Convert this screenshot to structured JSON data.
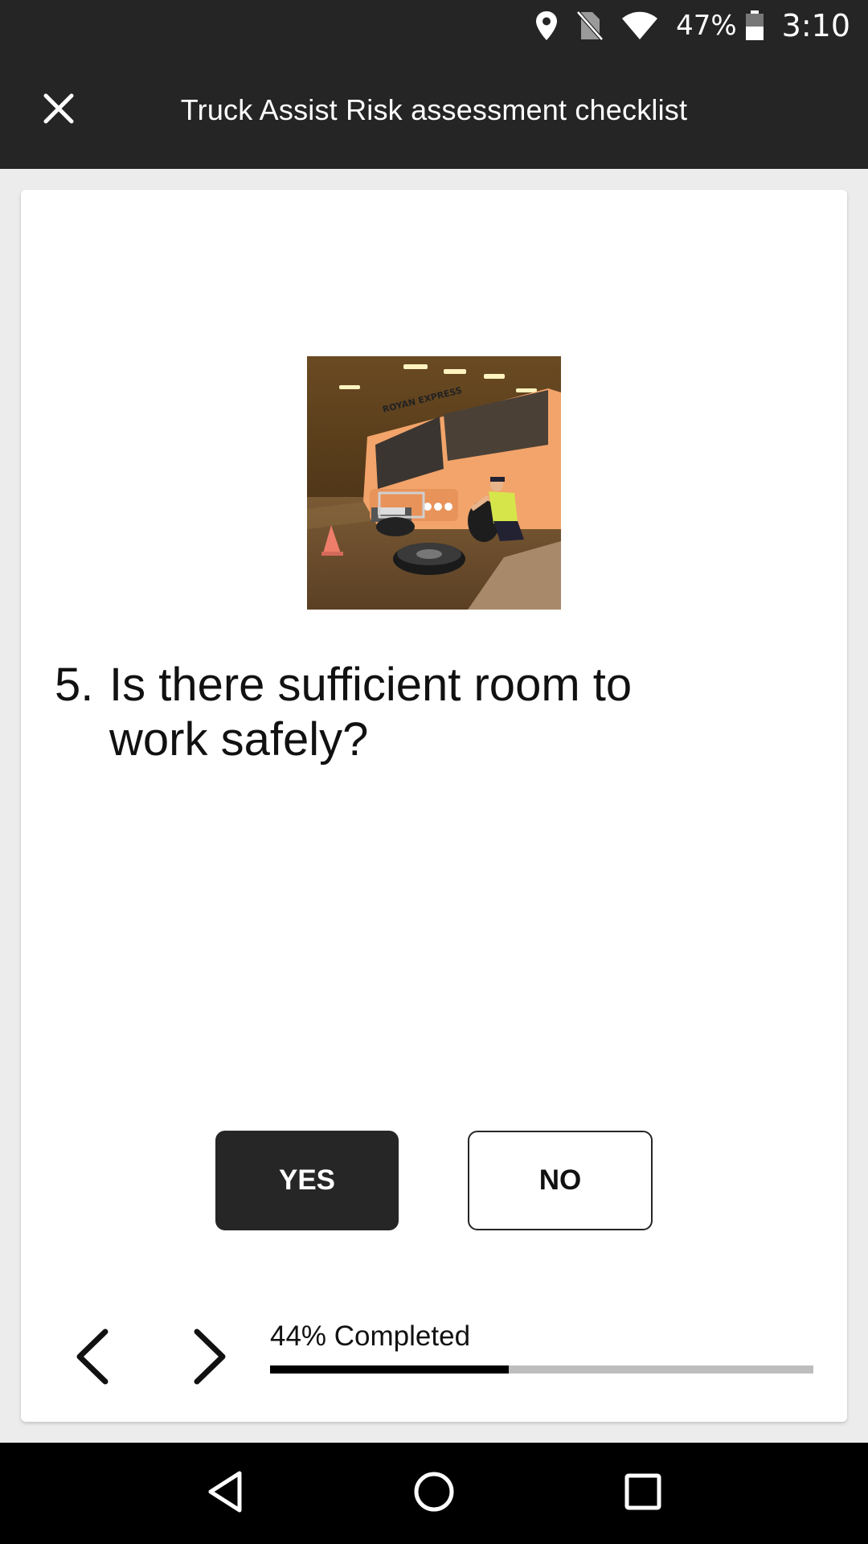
{
  "status_bar": {
    "battery_percent": "47%",
    "time": "3:10",
    "icons": [
      "location-icon",
      "no-sim-icon",
      "wifi-icon",
      "battery-icon"
    ]
  },
  "app_bar": {
    "title": "Truck Assist Risk assessment checklist",
    "close_icon": "close-icon"
  },
  "question": {
    "number": "5.",
    "text": "Is there sufficient room to work safely?",
    "image_icon": "bus-photo"
  },
  "answers": {
    "yes_label": "YES",
    "no_label": "NO",
    "selected": "YES"
  },
  "progress": {
    "label": "44% Completed",
    "value": 0.44
  },
  "navigation": {
    "prev_icon": "chevron-left-icon",
    "next_icon": "chevron-right-icon"
  },
  "system_nav": {
    "icons": [
      "back-icon",
      "home-icon",
      "recents-icon"
    ]
  },
  "colors": {
    "bar_dark": "#252525",
    "accent": "#262626",
    "progress_fill": "#000000",
    "progress_track": "#bdbdbd"
  }
}
